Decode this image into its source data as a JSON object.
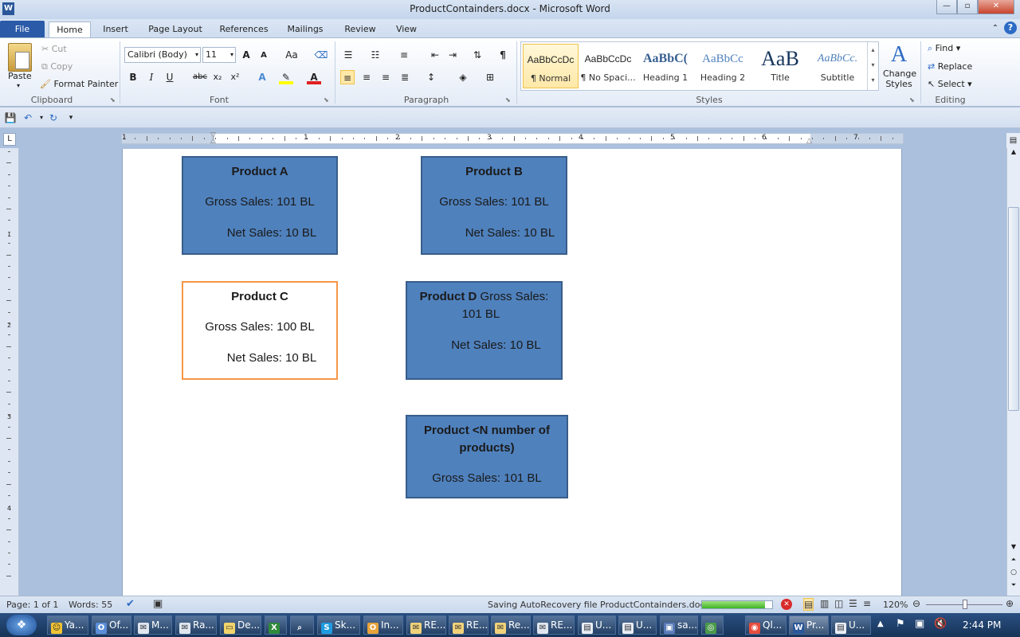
{
  "window": {
    "title": "ProductContainders.docx - Microsoft Word",
    "app_icon": "W",
    "minimize": "—",
    "maximize": "▫",
    "close": "✕"
  },
  "tabs": [
    "File",
    "Home",
    "Insert",
    "Page Layout",
    "References",
    "Mailings",
    "Review",
    "View"
  ],
  "ribbon": {
    "clipboard": {
      "paste": "Paste",
      "cut": "Cut",
      "copy": "Copy",
      "format_painter": "Format Painter",
      "label": "Clipboard"
    },
    "font": {
      "family": "Calibri (Body)",
      "size": "11",
      "grow": "A",
      "shrink": "A",
      "case": "Aa",
      "bold": "B",
      "italic": "I",
      "underline": "U",
      "strike": "abc",
      "sub": "x₂",
      "sup": "x²",
      "label": "Font"
    },
    "paragraph": {
      "label": "Paragraph",
      "pilcrow": "¶"
    },
    "styles": {
      "label": "Styles",
      "change_styles": "Change Styles",
      "items": [
        {
          "preview": "AaBbCcDc",
          "name": "¶ Normal"
        },
        {
          "preview": "AaBbCcDc",
          "name": "¶ No Spaci..."
        },
        {
          "preview": "AaBbC(",
          "name": "Heading 1"
        },
        {
          "preview": "AaBbCc",
          "name": "Heading 2"
        },
        {
          "preview": "AaB",
          "name": "Title"
        },
        {
          "preview": "AaBbCc.",
          "name": "Subtitle"
        }
      ]
    },
    "editing": {
      "find": "Find",
      "replace": "Replace",
      "select": "Select",
      "label": "Editing"
    }
  },
  "ruler": {
    "numbers": [
      "1",
      "1",
      "2",
      "3",
      "4",
      "5",
      "6",
      "7"
    ],
    "vnumbers": [
      "1",
      "2",
      "3",
      "4",
      "5"
    ]
  },
  "document": {
    "boxes": [
      {
        "title": "Product A",
        "lines": [
          "Gross Sales: 101 BL",
          "Net Sales: 10 BL"
        ]
      },
      {
        "title": "Product B",
        "lines": [
          "Gross Sales: 101 BL",
          "Net Sales: 10 BL"
        ]
      },
      {
        "title": "Product C",
        "lines": [
          "Gross Sales: 100 BL",
          "Net Sales: 10 BL"
        ]
      },
      {
        "title": "Product D",
        "inline": "Gross Sales:",
        "lines": [
          "101 BL",
          "Net Sales: 10 BL"
        ]
      },
      {
        "title": "Product <N number of",
        "title2": "products)",
        "lines": [
          "Gross Sales: 101 BL"
        ]
      }
    ]
  },
  "status": {
    "page": "Page: 1 of 1",
    "words": "Words: 55",
    "autorecovery": "Saving AutoRecovery file ProductContainders.docx:",
    "autosave_progress": 0.9,
    "zoom": "120%"
  },
  "taskbar": {
    "items": [
      "Ya...",
      "Of...",
      "M...",
      "Ra...",
      "De...",
      "",
      "",
      "Sk...",
      "In...",
      "RE...",
      "RE...",
      "Re...",
      "RE...",
      "U...",
      "U...",
      "sa...",
      "",
      "Ql...",
      "Pr...",
      "U..."
    ],
    "clock": "2:44 PM"
  },
  "colors": {
    "box_fill": "#4f81bd",
    "box_border": "#385d8a",
    "selected_border": "#f79646",
    "file_tab": "#2a5aa8"
  }
}
